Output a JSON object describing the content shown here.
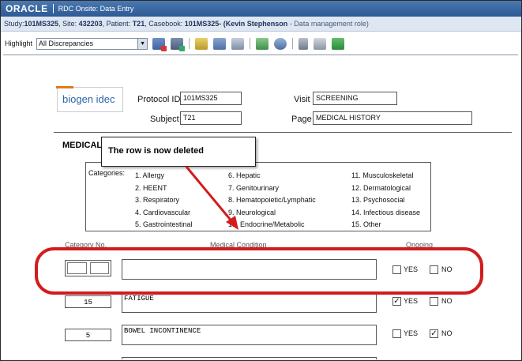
{
  "window": {
    "brand": "ORACLE",
    "title": "RDC Onsite: Data Entry"
  },
  "study_bar": {
    "study_label": "Study:",
    "study": "101MS325",
    "site_label": ", Site:",
    "site": "432203",
    "patient_label": ", Patient:",
    "patient": "T21",
    "casebook_label": ", Casebook:",
    "casebook": "101MS325-",
    "user": "(Kevin Stephenson",
    "role": " - Data management role)"
  },
  "toolbar": {
    "highlight_label": "Highlight",
    "highlight_value": "All Discrepancies",
    "icons": [
      "add-discrepancy-icon",
      "view-discrepancy-icon",
      "edit-icon",
      "audit-icon",
      "investigator-comment-icon",
      "verify-icon",
      "approve-icon",
      "delete-icon",
      "print-icon",
      "save-icon"
    ]
  },
  "form": {
    "logo_text": "biogen idec",
    "protocol_label": "Protocol ID",
    "protocol_value": "101MS325",
    "visit_label": "Visit",
    "visit_value": "SCREENING",
    "subject_label": "Subject",
    "subject_value": "T21",
    "page_label": "Page",
    "page_value": "MEDICAL HISTORY",
    "section_title": "MEDICAL",
    "categories_label": "Categories:",
    "categories_col1": [
      "1. Allergy",
      "2. HEENT",
      "3. Respiratory",
      "4. Cardiovascular",
      "5. Gastrointestinal"
    ],
    "categories_col2": [
      "6. Hepatic",
      "7. Genitourinary",
      "8. Hematopoietic/Lymphatic",
      "9. Neurological",
      "10. Endocrine/Metabolic"
    ],
    "categories_col3": [
      "11. Musculoskeletal",
      "12. Dermatological",
      "13. Psychosocial",
      "14. Infectious disease",
      "15. Other"
    ],
    "col_category": "Category No.",
    "col_condition": "Medical Condition",
    "col_ongoing": "Ongoing",
    "yes_label": "YES",
    "no_label": "NO",
    "rows": [
      {
        "category": "",
        "condition": "",
        "yes": false,
        "no": false
      },
      {
        "category": "15",
        "condition": "FATIGUE",
        "yes": true,
        "no": false
      },
      {
        "category": "5",
        "condition": "BOWEL INCONTINENCE",
        "yes": false,
        "no": true
      }
    ]
  },
  "callout": {
    "text": "The row is now deleted"
  },
  "colors": {
    "highlight": "#d21c1c",
    "titlebar": "#2d5a94",
    "logo_orange": "#e07a1f",
    "logo_blue": "#2a66a8"
  }
}
